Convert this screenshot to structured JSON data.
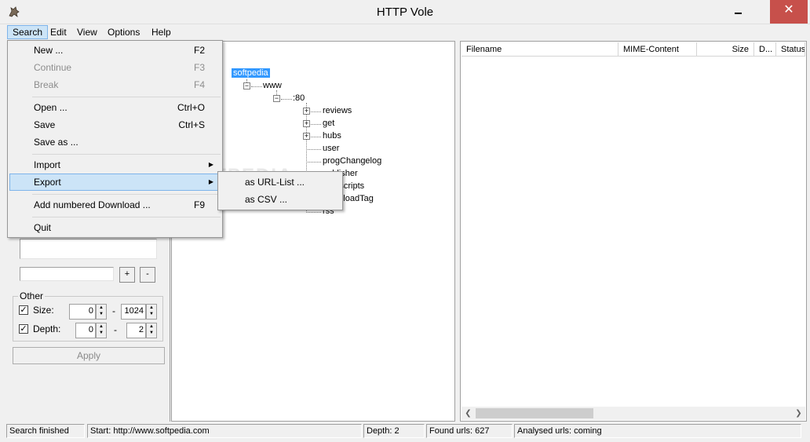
{
  "window": {
    "title": "HTTP Vole",
    "close_glyph": "✕"
  },
  "menubar": [
    "Search",
    "Edit",
    "View",
    "Options",
    "Help"
  ],
  "search_menu": {
    "items": [
      {
        "label": "New ...",
        "shortcut": "F2",
        "enabled": true
      },
      {
        "label": "Continue",
        "shortcut": "F3",
        "enabled": false
      },
      {
        "label": "Break",
        "shortcut": "F4",
        "enabled": false
      },
      {
        "label": "Open ...",
        "shortcut": "Ctrl+O",
        "enabled": true
      },
      {
        "label": "Save",
        "shortcut": "Ctrl+S",
        "enabled": true
      },
      {
        "label": "Save as ...",
        "shortcut": "",
        "enabled": true
      },
      {
        "label": "Import",
        "shortcut": "",
        "enabled": true,
        "submenu": true
      },
      {
        "label": "Export",
        "shortcut": "",
        "enabled": true,
        "submenu": true,
        "highlighted": true
      },
      {
        "label": "Add numbered Download ...",
        "shortcut": "F9",
        "enabled": true
      },
      {
        "label": "Quit",
        "shortcut": "",
        "enabled": true
      }
    ]
  },
  "export_submenu": [
    "as URL-List ...",
    "as CSV ..."
  ],
  "left_panel": {
    "add_button": "+",
    "remove_button": "-",
    "other_group": {
      "label": "Other",
      "size_label": "Size:",
      "size_checked": true,
      "size_min": "0",
      "size_separator": "-",
      "size_max": "1024",
      "depth_label": "Depth:",
      "depth_checked": true,
      "depth_min": "0",
      "depth_separator": "-",
      "depth_max": "2"
    },
    "apply_button": "Apply"
  },
  "tree": {
    "root": "softpedia",
    "www": "www",
    "port": ":80",
    "children": [
      "reviews",
      "get",
      "hubs",
      "user",
      "progChangelog",
      "publisher",
      "dyn-scripts",
      "downloadTag",
      "rss"
    ]
  },
  "file_list": {
    "columns": [
      "Filename",
      "MIME-Content",
      "Size",
      "D...",
      "Status"
    ]
  },
  "status_bar": {
    "state": "Search finished",
    "start": "Start: http://www.softpedia.com",
    "depth": "Depth: 2",
    "found": "Found urls: 627",
    "analysed": "Analysed urls: coming"
  },
  "watermark": "SOFTPEDIA",
  "colors": {
    "selection": "#3399ff",
    "menu_highlight": "#cce4f7",
    "close_button": "#c7504b"
  }
}
